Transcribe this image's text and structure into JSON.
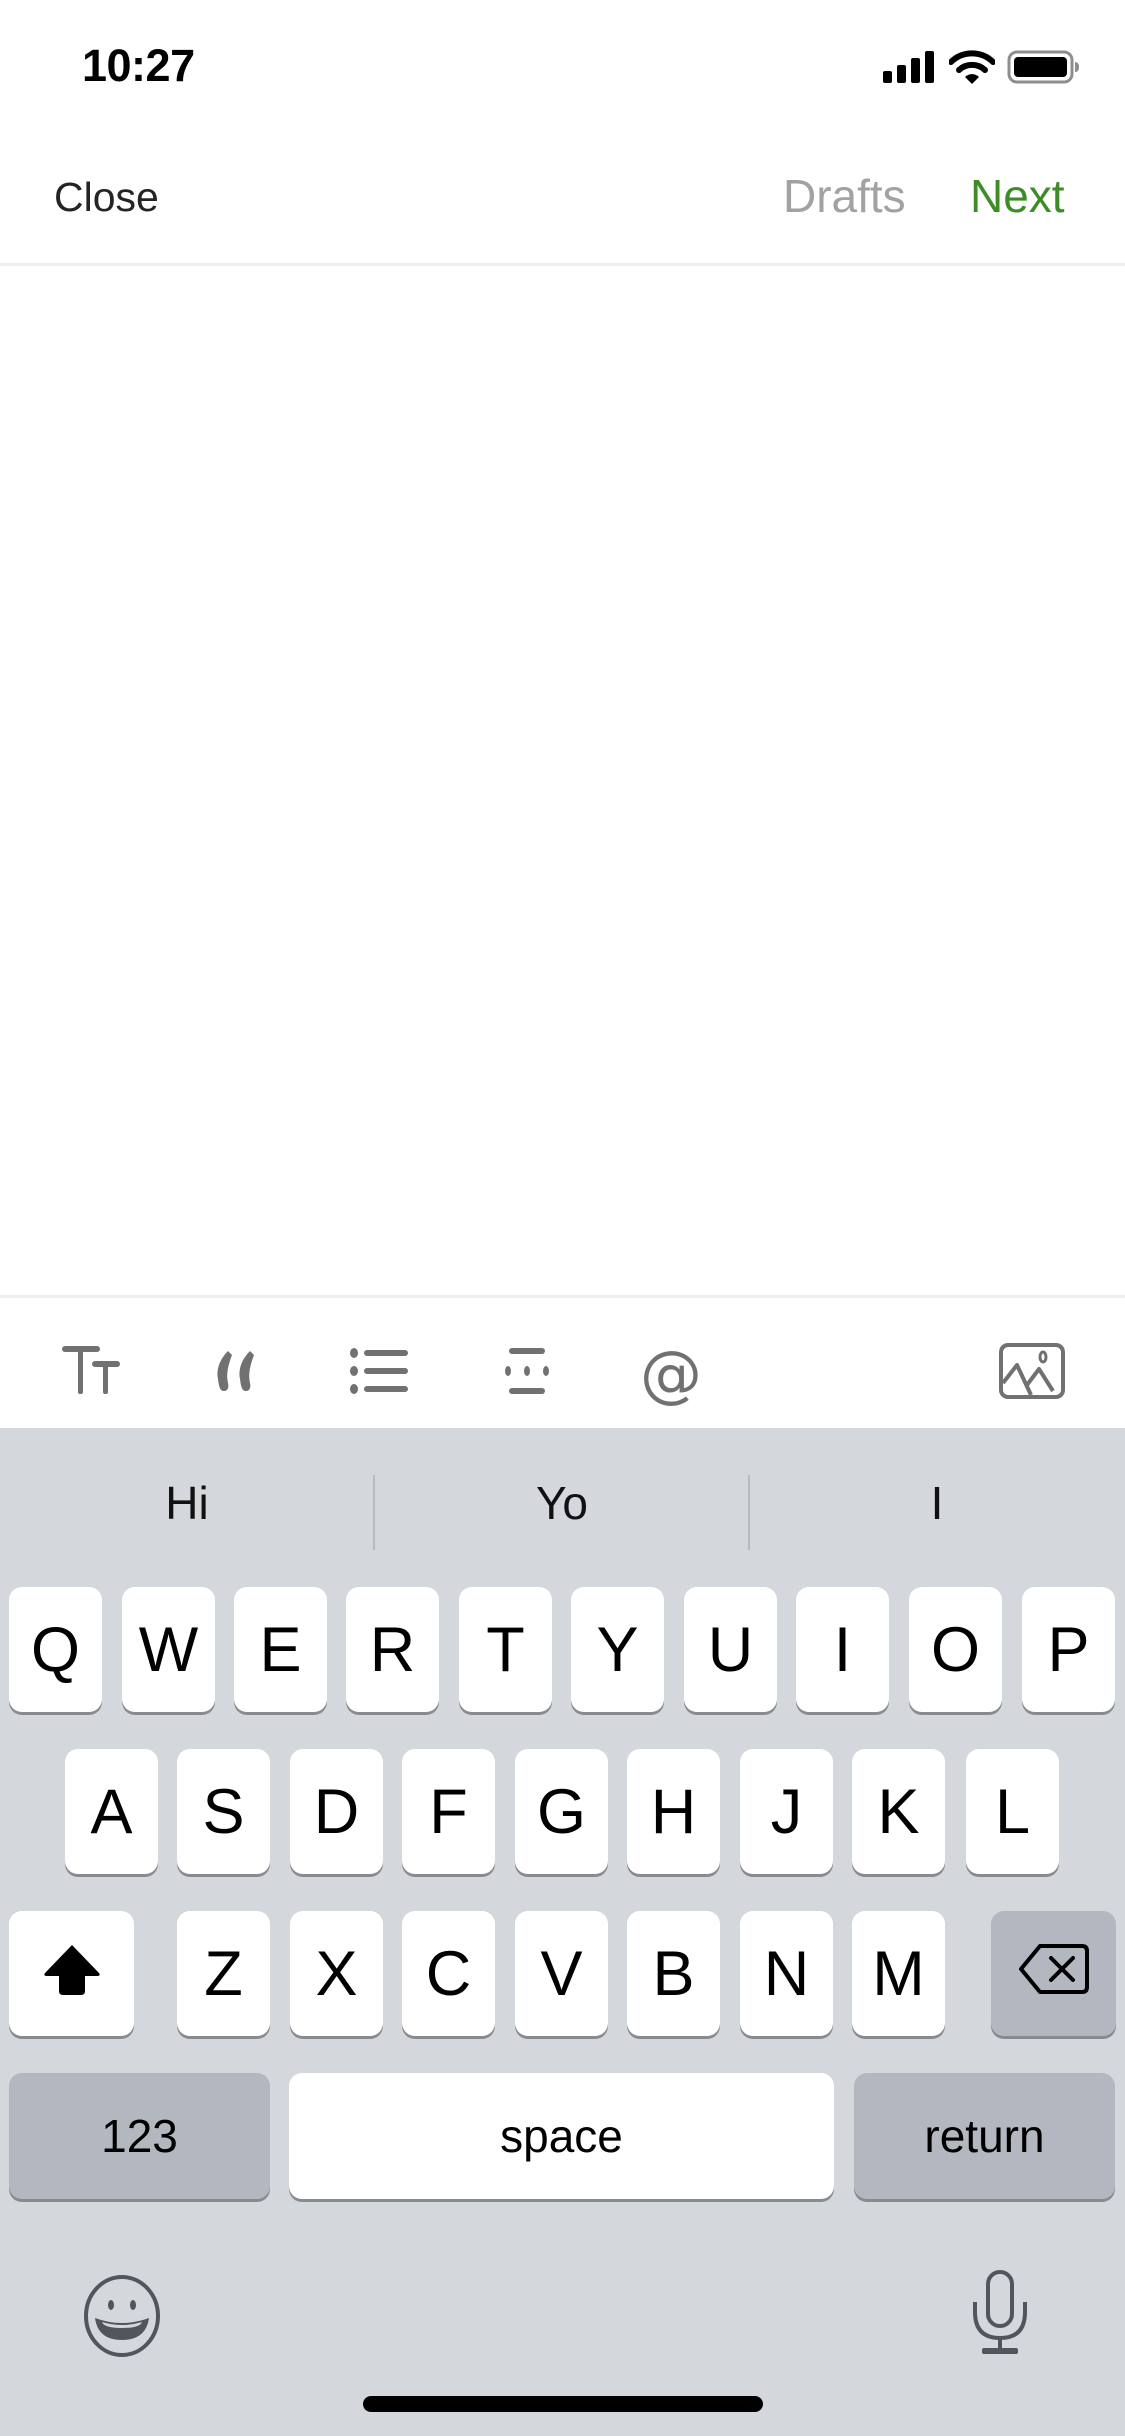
{
  "status_bar": {
    "time": "10:27",
    "icons": [
      "cellular-signal-icon",
      "wifi-icon",
      "battery-icon"
    ]
  },
  "header": {
    "close_label": "Close",
    "drafts_label": "Drafts",
    "next_label": "Next",
    "colors": {
      "next": "#3d8c26",
      "drafts": "#a2a2a2",
      "close": "#242424"
    }
  },
  "editor": {
    "content": ""
  },
  "toolbar": {
    "items": [
      {
        "name": "text-size-icon"
      },
      {
        "name": "quote-icon"
      },
      {
        "name": "bulleted-list-icon"
      },
      {
        "name": "separator-icon"
      },
      {
        "name": "mention-icon",
        "glyph": "@"
      },
      {
        "name": "image-icon"
      }
    ]
  },
  "keyboard": {
    "suggestions": [
      "Hi",
      "Yo",
      "I"
    ],
    "rows": [
      [
        "Q",
        "W",
        "E",
        "R",
        "T",
        "Y",
        "U",
        "I",
        "O",
        "P"
      ],
      [
        "A",
        "S",
        "D",
        "F",
        "G",
        "H",
        "J",
        "K",
        "L"
      ],
      [
        "Z",
        "X",
        "C",
        "V",
        "B",
        "N",
        "M"
      ]
    ],
    "numbers_label": "123",
    "space_label": "space",
    "return_label": "return",
    "emoji_icon": "emoji-icon",
    "mic_icon": "microphone-icon",
    "colors": {
      "background": "#d4d7dc",
      "key": "#ffffff",
      "function_key": "#b3b7bf"
    }
  }
}
